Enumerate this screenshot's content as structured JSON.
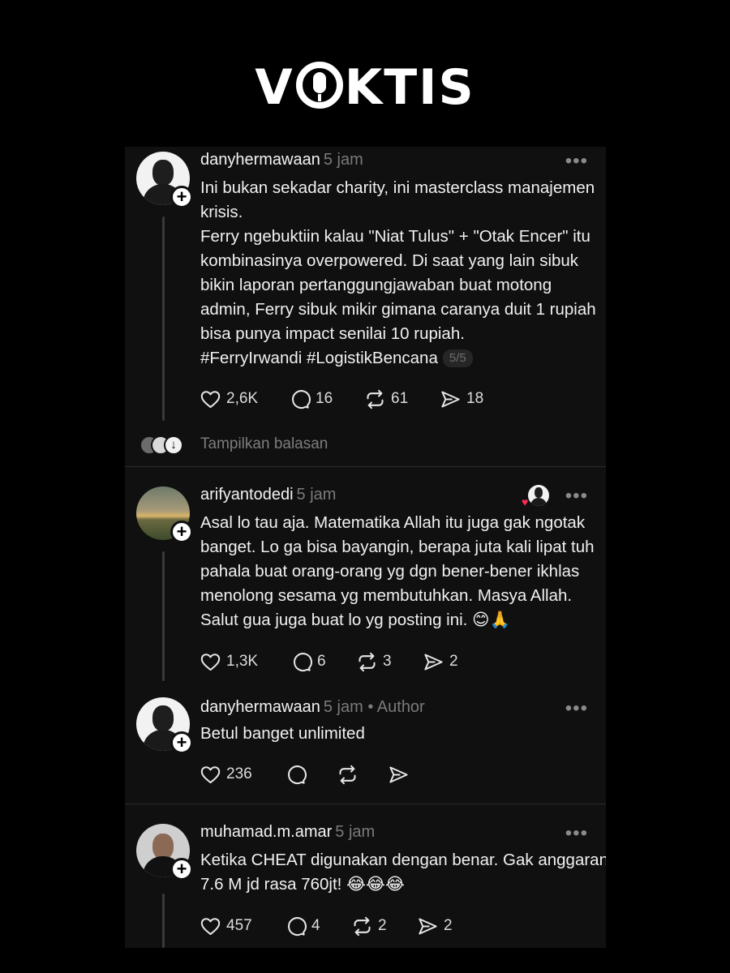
{
  "brand": {
    "pre": "V",
    "post": "KTIS"
  },
  "posts": [
    {
      "username": "danyhermawaan",
      "time": "5 jam",
      "lines": [
        "Ini bukan sekadar charity, ini masterclass manajemen",
        "krisis.",
        "Ferry ngebuktiin kalau \"Niat Tulus\" + \"Otak Encer\" itu",
        "kombinasinya overpowered. Di saat yang lain sibuk",
        "bikin laporan pertanggungjawaban buat motong",
        "admin, Ferry sibuk mikir gimana caranya duit 1 rupiah",
        "bisa punya impact senilai 10 rupiah.",
        "#FerryIrwandi #LogistikBencana"
      ],
      "counter": "5/5",
      "likes": "2,6K",
      "replies": "16",
      "reposts": "61",
      "shares": "18",
      "show_replies": "Tampilkan balasan"
    },
    {
      "username": "arifyantodedi",
      "time": "5 jam",
      "lines": [
        "Asal lo tau aja. Matematika Allah itu juga gak ngotak",
        "banget. Lo ga bisa bayangin, berapa juta kali lipat tuh",
        "pahala buat orang-orang yg dgn bener-bener ikhlas",
        "menolong sesama yg membutuhkan. Masya Allah.",
        "Salut gua juga buat lo yg posting ini. 😊🙏"
      ],
      "likes": "1,3K",
      "replies": "6",
      "reposts": "3",
      "shares": "2"
    },
    {
      "username": "danyhermawaan",
      "time": "5 jam • Author",
      "lines": [
        "Betul banget unlimited"
      ],
      "likes": "236"
    },
    {
      "username": "muhamad.m.amar",
      "time": "5 jam",
      "lines": [
        "Ketika CHEAT digunakan dengan benar. Gak anggaran",
        "7.6 M jd rasa 760jt! 😂😂😂"
      ],
      "likes": "457",
      "replies": "4",
      "reposts": "2",
      "shares": "2"
    }
  ],
  "icons": {
    "like": "heart-icon",
    "reply": "comment-icon",
    "repost": "repost-icon",
    "share": "send-icon",
    "more": "more-icon",
    "follow": "plus-icon"
  },
  "colors": {
    "background": "#000000",
    "card": "#101010",
    "muted": "#7a7a7a",
    "text": "#f3f3f3",
    "badge": "#ff2d55"
  }
}
